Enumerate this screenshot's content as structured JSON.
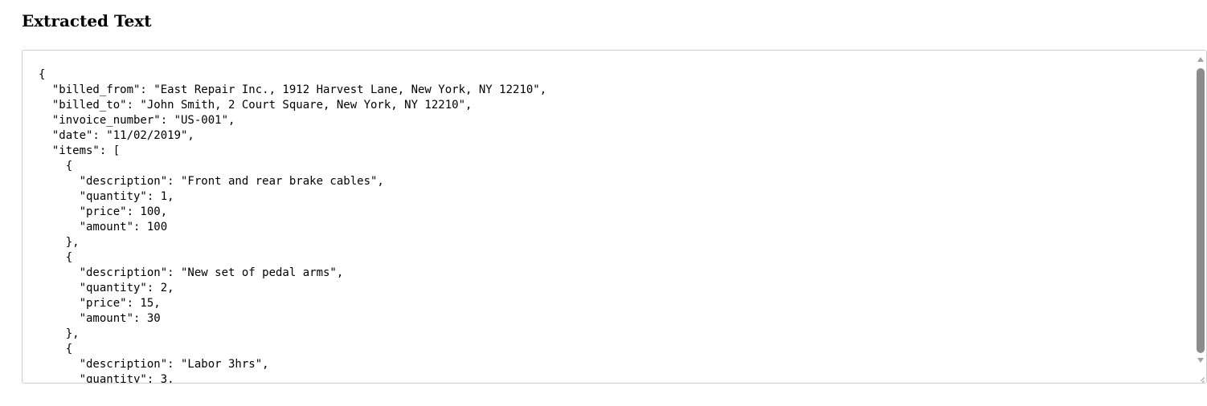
{
  "page": {
    "heading": "Extracted Text"
  },
  "extracted_text": {
    "content": "{\n  \"billed_from\": \"East Repair Inc., 1912 Harvest Lane, New York, NY 12210\",\n  \"billed_to\": \"John Smith, 2 Court Square, New York, NY 12210\",\n  \"invoice_number\": \"US-001\",\n  \"date\": \"11/02/2019\",\n  \"items\": [\n    {\n      \"description\": \"Front and rear brake cables\",\n      \"quantity\": 1,\n      \"price\": 100,\n      \"amount\": 100\n    },\n    {\n      \"description\": \"New set of pedal arms\",\n      \"quantity\": 2,\n      \"price\": 15,\n      \"amount\": 30\n    },\n    {\n      \"description\": \"Labor 3hrs\",\n      \"quantity\": 3,"
  },
  "icons": {
    "scroll_up": "scroll-up-arrow-icon",
    "scroll_down": "scroll-down-arrow-icon",
    "resize": "resize-grip-icon"
  }
}
